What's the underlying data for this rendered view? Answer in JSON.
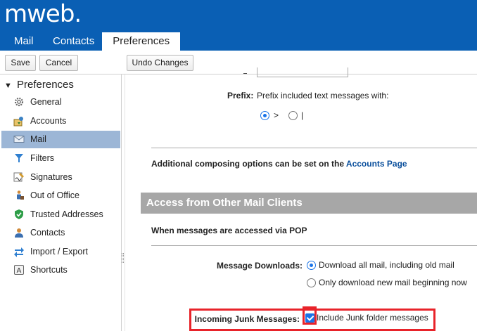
{
  "header": {
    "logo": "mweb.",
    "tabs": [
      {
        "label": "Mail"
      },
      {
        "label": "Contacts"
      },
      {
        "label": "Preferences"
      }
    ]
  },
  "toolbar": {
    "save_label": "Save",
    "cancel_label": "Cancel",
    "undo_label": "Undo Changes"
  },
  "sidebar": {
    "root_label": "Preferences",
    "items": [
      {
        "label": "General",
        "icon": "gear-icon"
      },
      {
        "label": "Accounts",
        "icon": "accounts-icon"
      },
      {
        "label": "Mail",
        "icon": "envelope-icon",
        "selected": true
      },
      {
        "label": "Filters",
        "icon": "filter-icon"
      },
      {
        "label": "Signatures",
        "icon": "signature-icon"
      },
      {
        "label": "Out of Office",
        "icon": "out-of-office-icon"
      },
      {
        "label": "Trusted Addresses",
        "icon": "shield-icon"
      },
      {
        "label": "Contacts",
        "icon": "contacts-icon"
      },
      {
        "label": "Import / Export",
        "icon": "import-export-icon"
      },
      {
        "label": "Shortcuts",
        "icon": "shortcuts-icon"
      }
    ]
  },
  "main": {
    "prefix_label": "Prefix:",
    "prefix_text": "Prefix included text messages with:",
    "prefix_options": [
      {
        "label": ">",
        "selected": true
      },
      {
        "label": "|",
        "selected": false
      }
    ],
    "compose_note": "Additional composing options can be set on the",
    "compose_link": "Accounts Page",
    "section_title": "Access from Other Mail Clients",
    "pop_note": "When messages are accessed via POP",
    "downloads_label": "Message Downloads:",
    "downloads_options": [
      {
        "label": "Download all mail, including old mail",
        "selected": true
      },
      {
        "label": "Only download new mail beginning now",
        "selected": false
      }
    ],
    "junk_label": "Incoming Junk Messages:",
    "junk_option": {
      "label": "Include Junk folder messages",
      "checked": true
    }
  },
  "colors": {
    "header": "#0a5fb4",
    "selected_nav": "#9cb6d6",
    "section_bar": "#a7a7a7",
    "highlight": "#e8232a",
    "accent": "#1a73e8"
  }
}
